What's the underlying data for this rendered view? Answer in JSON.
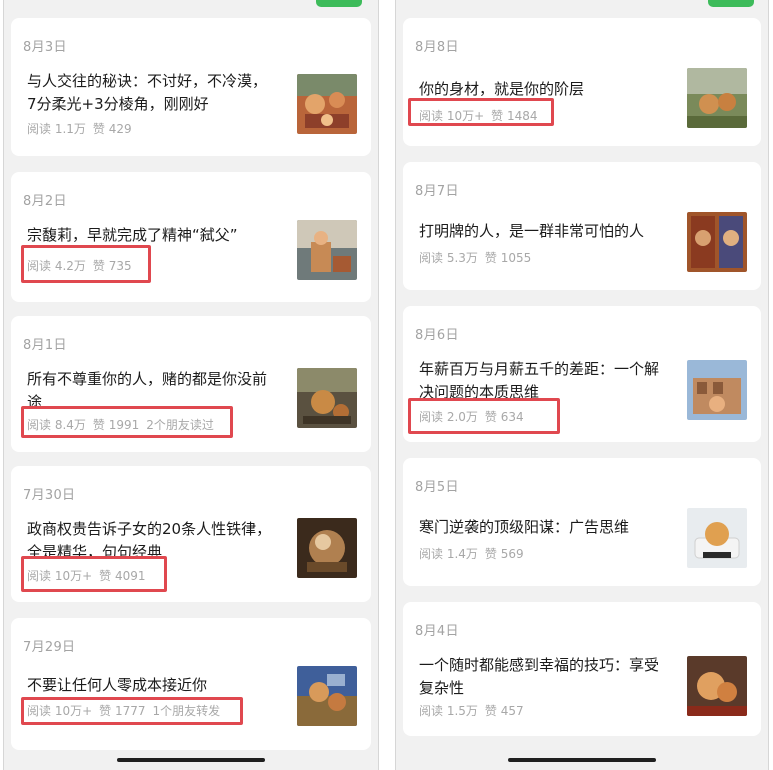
{
  "left_panel": {
    "articles": [
      {
        "date": "8月3日",
        "title_line1": "与人交往的秘诀：不讨好，不冷漠，",
        "title_line2": "7分柔光+3分棱角，刚刚好",
        "reads": "阅读 1.1万",
        "likes": "赞 429",
        "extra": "",
        "thumb_icon": "painting-thumbnail"
      },
      {
        "date": "8月2日",
        "title_line1": "宗馥莉，早就完成了精神“弑父”",
        "title_line2": "",
        "reads": "阅读 4.2万",
        "likes": "赞 735",
        "extra": "",
        "thumb_icon": "painting-thumbnail"
      },
      {
        "date": "8月1日",
        "title_line1": "所有不尊重你的人，赌的都是你没前",
        "title_line2": "途",
        "reads": "阅读 8.4万",
        "likes": "赞 1991",
        "extra": "2个朋友读过",
        "thumb_icon": "painting-thumbnail"
      },
      {
        "date": "7月30日",
        "title_line1": "政商权贵告诉子女的20条人性铁律，",
        "title_line2": "全是精华，句句经典",
        "reads": "阅读 10万+",
        "likes": "赞 4091",
        "extra": "",
        "thumb_icon": "painting-thumbnail"
      },
      {
        "date": "7月29日",
        "title_line1": "不要让任何人零成本接近你",
        "title_line2": "",
        "reads": "阅读 10万+",
        "likes": "赞 1777",
        "extra": "1个朋友转发",
        "thumb_icon": "painting-thumbnail"
      }
    ]
  },
  "right_panel": {
    "articles": [
      {
        "date": "8月8日",
        "title_line1": "你的身材，就是你的阶层",
        "title_line2": "",
        "reads": "阅读 10万+",
        "likes": "赞 1484",
        "extra": "",
        "thumb_icon": "painting-thumbnail"
      },
      {
        "date": "8月7日",
        "title_line1": "打明牌的人，是一群非常可怕的人",
        "title_line2": "",
        "reads": "阅读 5.3万",
        "likes": "赞 1055",
        "extra": "",
        "thumb_icon": "painting-thumbnail"
      },
      {
        "date": "8月6日",
        "title_line1": "年薪百万与月薪五千的差距：一个解",
        "title_line2": "决问题的本质思维",
        "reads": "阅读 2.0万",
        "likes": "赞 634",
        "extra": "",
        "thumb_icon": "painting-thumbnail"
      },
      {
        "date": "8月5日",
        "title_line1": "寒门逆袭的顶级阳谋：广告思维",
        "title_line2": "",
        "reads": "阅读 1.4万",
        "likes": "赞 569",
        "extra": "",
        "thumb_icon": "painting-thumbnail"
      },
      {
        "date": "8月4日",
        "title_line1": "一个随时都能感到幸福的技巧：享受",
        "title_line2": "复杂性",
        "reads": "阅读 1.5万",
        "likes": "赞 457",
        "extra": "",
        "thumb_icon": "painting-thumbnail"
      }
    ]
  },
  "colors": {
    "highlight": "#e0484f",
    "accent": "#3dbb5a",
    "background": "#f1f1f1",
    "card": "#ffffff",
    "meta_text": "#a8a8a8"
  }
}
